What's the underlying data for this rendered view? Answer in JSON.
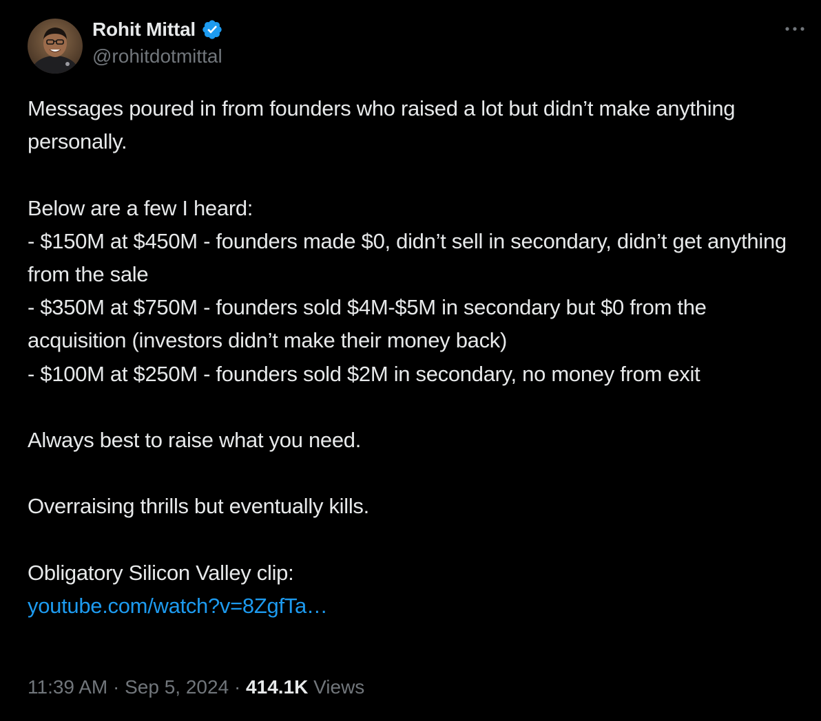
{
  "author": {
    "display_name": "Rohit Mittal",
    "handle": "@rohitdotmittal",
    "verified": true,
    "verified_color": "#1d9bf0"
  },
  "tweet": {
    "lines": {
      "p1": "Messages poured in from founders who raised a lot but didn’t make anything personally.",
      "p2_intro": "Below are a few I heard:",
      "p2_item1": "- $150M at $450M - founders made $0, didn’t sell in secondary, didn’t get anything from the sale",
      "p2_item2": "- $350M at $750M - founders sold $4M-$5M in secondary but $0 from the acquisition (investors didn’t make their money back)",
      "p2_item3": "- $100M at $250M - founders sold $2M in secondary, no money from exit",
      "p3": "Always best to raise what you need.",
      "p4": "Overraising thrills but eventually kills.",
      "p5": "Obligatory Silicon Valley clip:",
      "link": "youtube.com/watch?v=8ZgfTa…"
    },
    "link_color": "#1d9bf0"
  },
  "meta": {
    "time": "11:39 AM",
    "separator": "·",
    "date": "Sep 5, 2024",
    "views_count": "414.1K",
    "views_label": "Views"
  },
  "icons": {
    "verified": "verified-badge-icon",
    "more": "more-options-icon"
  }
}
